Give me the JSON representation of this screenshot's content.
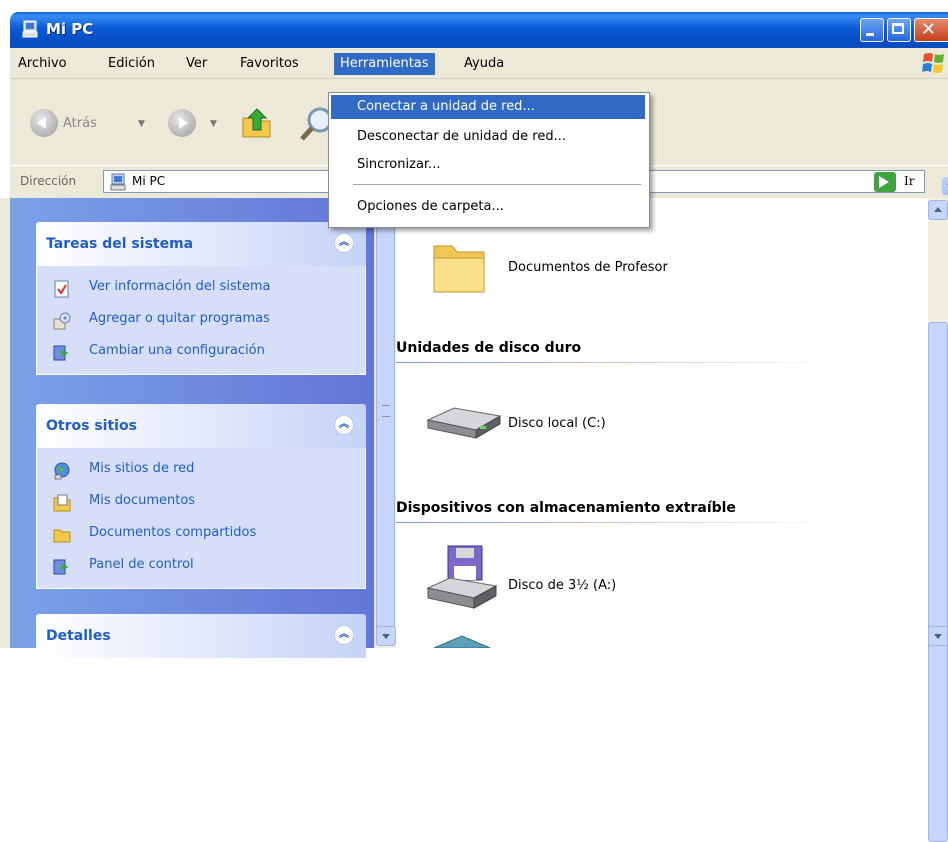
{
  "window": {
    "title": "Mi PC"
  },
  "menubar": {
    "items": [
      "Archivo",
      "Edición",
      "Ver",
      "Favoritos",
      "Herramientas",
      "Ayuda"
    ],
    "active": "Herramientas"
  },
  "toolbar": {
    "back_label": "Atrás"
  },
  "address": {
    "label": "Dirección",
    "value": "Mi PC",
    "go_label": "Ir"
  },
  "tools_menu": {
    "items": [
      "Conectar a unidad de red...",
      "Desconectar de unidad de red...",
      "Sincronizar...",
      "Opciones de carpeta..."
    ],
    "highlighted": "Conectar a unidad de red..."
  },
  "sidebar": {
    "system_tasks": {
      "title": "Tareas del sistema",
      "items": [
        "Ver información del sistema",
        "Agregar o quitar programas",
        "Cambiar una configuración"
      ]
    },
    "other_places": {
      "title": "Otros sitios",
      "items": [
        "Mis sitios de red",
        "Mis documentos",
        "Documentos compartidos",
        "Panel de control"
      ]
    },
    "details": {
      "title": "Detalles"
    }
  },
  "content": {
    "folder_item": "Documentos de Profesor",
    "hard_drives": {
      "heading": "Unidades de disco duro",
      "items": [
        "Disco local (C:)"
      ]
    },
    "removable": {
      "heading": "Dispositivos con almacenamiento extraíble",
      "items": [
        "Disco de 3½ (A:)"
      ]
    }
  },
  "colors": {
    "title_bar": "#0a5fd8",
    "menu_highlight": "#316ac5",
    "task_link": "#215dc6",
    "sidebar_bg": "#7ba2e7"
  }
}
